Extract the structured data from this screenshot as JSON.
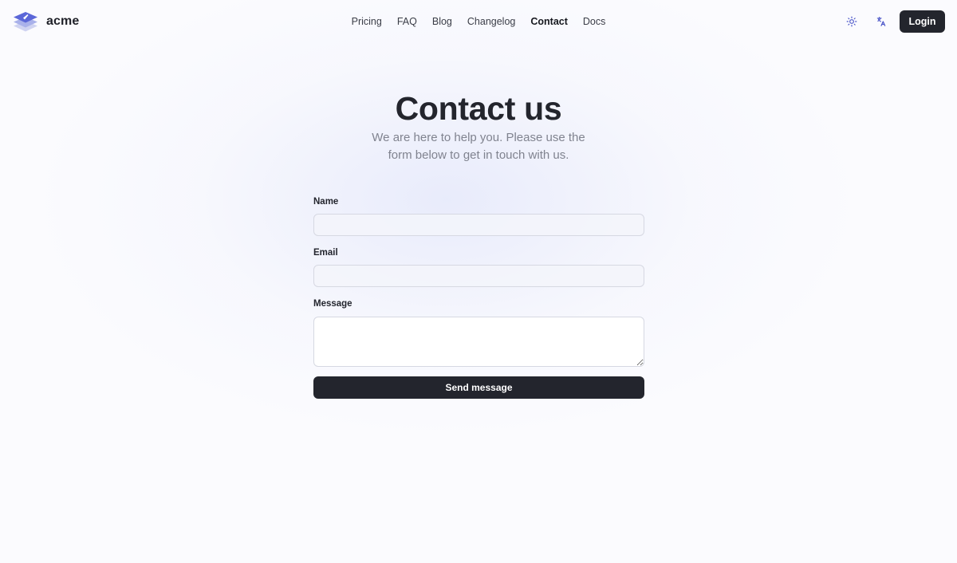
{
  "brand": {
    "name": "acme",
    "logo_icon": "acme-logo-icon"
  },
  "nav": {
    "items": [
      {
        "label": "Pricing",
        "active": false
      },
      {
        "label": "FAQ",
        "active": false
      },
      {
        "label": "Blog",
        "active": false
      },
      {
        "label": "Changelog",
        "active": false
      },
      {
        "label": "Contact",
        "active": true
      },
      {
        "label": "Docs",
        "active": false
      }
    ]
  },
  "header": {
    "theme_icon": "sun-icon",
    "language_icon": "translate-icon",
    "login_label": "Login"
  },
  "hero": {
    "title": "Contact us",
    "subtitle": "We are here to help you. Please use the form below to get in touch with us."
  },
  "form": {
    "name_label": "Name",
    "name_value": "",
    "email_label": "Email",
    "email_value": "",
    "message_label": "Message",
    "message_value": "",
    "submit_label": "Send message"
  },
  "colors": {
    "accent": "#4a55c8",
    "dark": "#23252d",
    "muted_text": "#80838f"
  }
}
